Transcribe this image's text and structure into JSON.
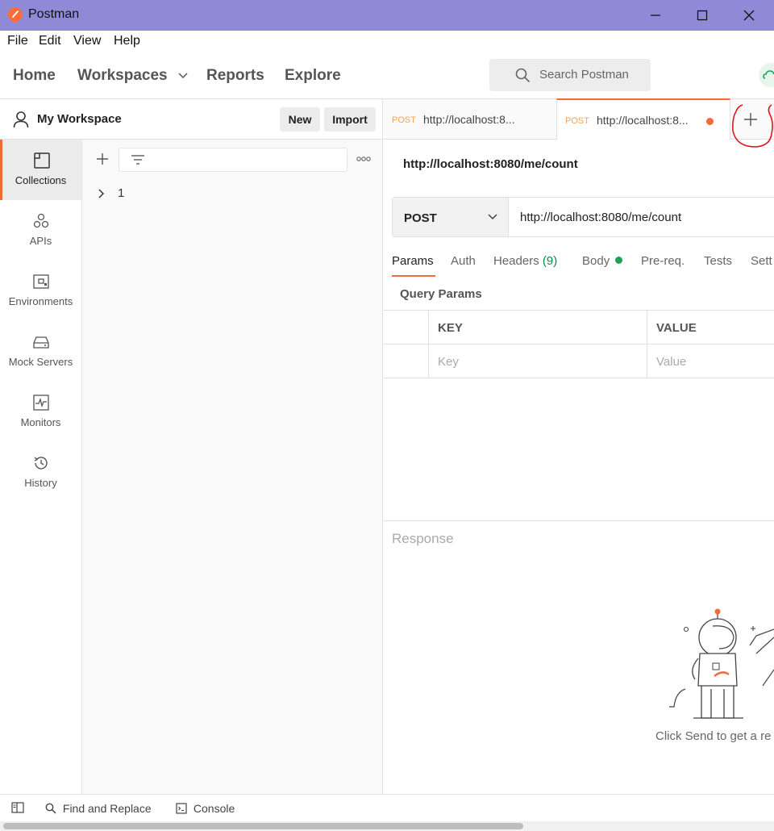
{
  "window": {
    "title": "Postman",
    "minimize": "—",
    "maximize": "☐",
    "close": "✕"
  },
  "menu": [
    "File",
    "Edit",
    "View",
    "Help"
  ],
  "nav": {
    "home": "Home",
    "workspaces": "Workspaces",
    "reports": "Reports",
    "explore": "Explore",
    "search_placeholder": "Search Postman"
  },
  "workspace": {
    "name": "My Workspace",
    "new_label": "New",
    "import_label": "Import"
  },
  "rail": [
    {
      "label": "Collections",
      "icon": "collections-icon",
      "active": true
    },
    {
      "label": "APIs",
      "icon": "apis-icon"
    },
    {
      "label": "Environments",
      "icon": "environments-icon"
    },
    {
      "label": "Mock Servers",
      "icon": "mock-servers-icon"
    },
    {
      "label": "Monitors",
      "icon": "monitors-icon"
    },
    {
      "label": "History",
      "icon": "history-icon"
    }
  ],
  "collections": {
    "items": [
      "1"
    ]
  },
  "tabs": [
    {
      "method": "POST",
      "url": "http://localhost:8..."
    },
    {
      "method": "POST",
      "url": "http://localhost:8...",
      "unsaved": true
    }
  ],
  "request": {
    "title": "http://localhost:8080/me/count",
    "method": "POST",
    "url": "http://localhost:8080/me/count",
    "tabs": {
      "params": "Params",
      "auth": "Auth",
      "headers": "Headers",
      "headers_count": "(9)",
      "body": "Body",
      "prereq": "Pre-req.",
      "tests": "Tests",
      "settings": "Sett"
    },
    "query_params_title": "Query Params",
    "table": {
      "key_header": "KEY",
      "value_header": "VALUE",
      "key_placeholder": "Key",
      "value_placeholder": "Value"
    }
  },
  "response": {
    "title": "Response",
    "hint": "Click Send to get a re"
  },
  "statusbar": {
    "find_replace": "Find and Replace",
    "console": "Console"
  },
  "colors": {
    "accent": "#f26b3a",
    "titlebar": "#8f8ad8",
    "method_post": "#f0a550",
    "headers_count": "#0b8a4a"
  }
}
